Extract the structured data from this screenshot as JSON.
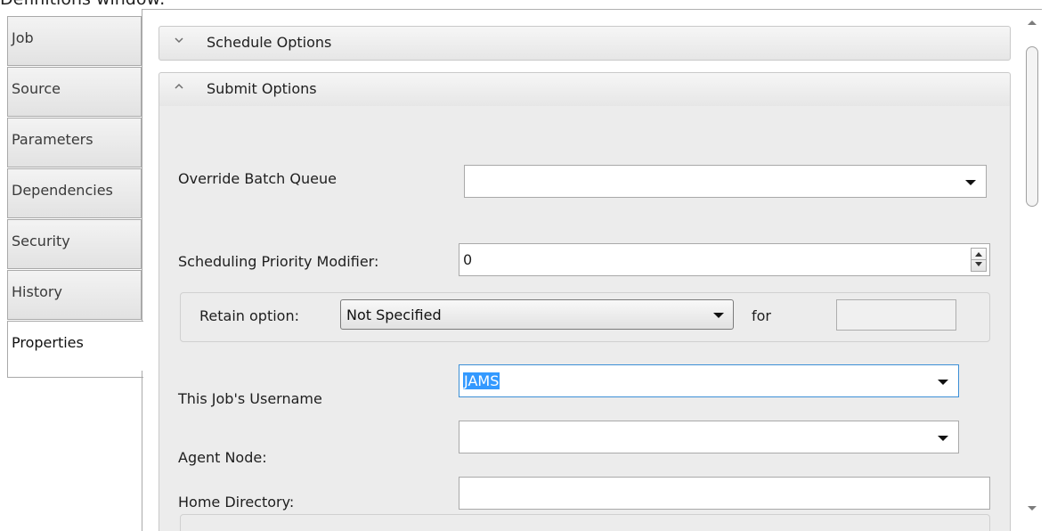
{
  "caption": "Definitions window:",
  "tabs": [
    {
      "label": "Job"
    },
    {
      "label": "Source"
    },
    {
      "label": "Parameters"
    },
    {
      "label": "Dependencies"
    },
    {
      "label": "Security"
    },
    {
      "label": "History"
    },
    {
      "label": "Properties",
      "active": true
    }
  ],
  "groups": {
    "schedule_options": {
      "title": "Schedule Options",
      "expanded": false
    },
    "submit_options": {
      "title": "Submit Options",
      "expanded": true
    }
  },
  "fields": {
    "override_batch_queue": {
      "label": "Override Batch Queue",
      "value": ""
    },
    "scheduling_priority": {
      "label": "Scheduling Priority Modifier:",
      "value": "0"
    },
    "retain": {
      "label": "Retain option:",
      "value": "Not Specified",
      "for_label": "for",
      "for_value": ""
    },
    "username": {
      "label": "This Job's Username",
      "value": "JAMS"
    },
    "agent_node": {
      "label": "Agent Node:",
      "value": ""
    },
    "home_directory": {
      "label": "Home Directory:",
      "value": ""
    }
  },
  "icons": {
    "collapse": "chevron-down-icon",
    "expand": "chevron-up-icon",
    "dropdown": "dropdown-arrow-icon",
    "spinner": "spinner-icon"
  },
  "colors": {
    "selection": "#3399ff",
    "panel": "#ececec",
    "header": "#e6e6e6"
  }
}
